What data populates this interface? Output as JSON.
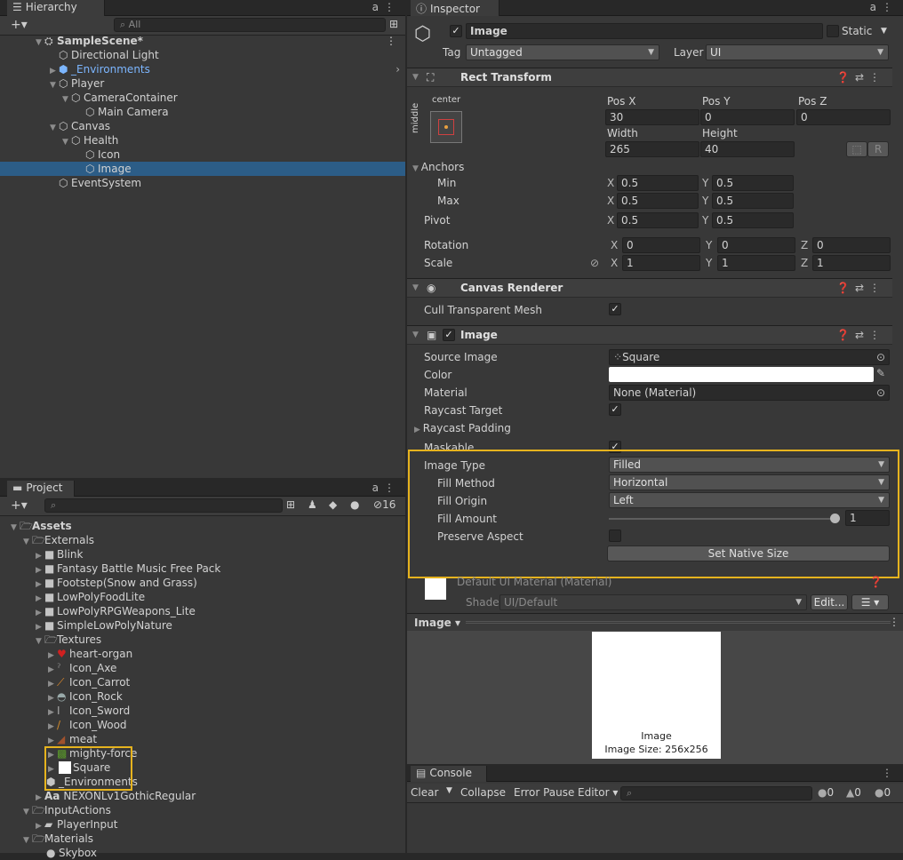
{
  "hierarchy": {
    "tab": "Hierarchy",
    "search_placeholder": "All",
    "add_label": "+▾",
    "items": [
      {
        "label": "SampleScene*"
      },
      {
        "label": "Directional Light"
      },
      {
        "label": "_Environments"
      },
      {
        "label": "Player"
      },
      {
        "label": "CameraContainer"
      },
      {
        "label": "Main Camera"
      },
      {
        "label": "Canvas"
      },
      {
        "label": "Health"
      },
      {
        "label": "Icon"
      },
      {
        "label": "Image"
      },
      {
        "label": "EventSystem"
      }
    ]
  },
  "project": {
    "tab": "Project",
    "add_label": "+▾",
    "hidden_count": "16",
    "items": [
      {
        "label": "Assets"
      },
      {
        "label": "Externals"
      },
      {
        "label": "Blink"
      },
      {
        "label": "Fantasy Battle Music Free Pack"
      },
      {
        "label": "Footstep(Snow and Grass)"
      },
      {
        "label": "LowPolyFoodLite"
      },
      {
        "label": "LowPolyRPGWeapons_Lite"
      },
      {
        "label": "SimpleLowPolyNature"
      },
      {
        "label": "Textures"
      },
      {
        "label": "heart-organ"
      },
      {
        "label": "Icon_Axe"
      },
      {
        "label": "Icon_Carrot"
      },
      {
        "label": "Icon_Rock"
      },
      {
        "label": "Icon_Sword"
      },
      {
        "label": "Icon_Wood"
      },
      {
        "label": "meat"
      },
      {
        "label": "mighty-force"
      },
      {
        "label": "Square"
      },
      {
        "label": "_Environments"
      },
      {
        "label": "NEXONLv1GothicRegular"
      },
      {
        "label": "InputActions"
      },
      {
        "label": "PlayerInput"
      },
      {
        "label": "Materials"
      },
      {
        "label": "Skybox"
      }
    ],
    "font_icon_label": "Aa"
  },
  "inspector": {
    "tab": "Inspector",
    "object_name": "Image",
    "static_label": "Static",
    "tag_label": "Tag",
    "tag_value": "Untagged",
    "layer_label": "Layer",
    "layer_value": "UI",
    "rect_transform": {
      "title": "Rect Transform",
      "anchor_h": "center",
      "anchor_v": "middle",
      "posx_label": "Pos X",
      "posx": "30",
      "posy_label": "Pos Y",
      "posy": "0",
      "posz_label": "Pos Z",
      "posz": "0",
      "width_label": "Width",
      "width": "265",
      "height_label": "Height",
      "height": "40",
      "r_label": "R",
      "anchors_label": "Anchors",
      "min_label": "Min",
      "min_x": "0.5",
      "min_y": "0.5",
      "max_label": "Max",
      "max_x": "0.5",
      "max_y": "0.5",
      "pivot_label": "Pivot",
      "pivot_x": "0.5",
      "pivot_y": "0.5",
      "rotation_label": "Rotation",
      "rot_x": "0",
      "rot_y": "0",
      "rot_z": "0",
      "scale_label": "Scale",
      "scale_x": "1",
      "scale_y": "1",
      "scale_z": "1",
      "x": "X",
      "y": "Y",
      "z": "Z"
    },
    "canvas_renderer": {
      "title": "Canvas Renderer",
      "cull_label": "Cull Transparent Mesh"
    },
    "image": {
      "title": "Image",
      "source_label": "Source Image",
      "source_value": "Square",
      "color_label": "Color",
      "material_label": "Material",
      "material_value": "None (Material)",
      "raycast_label": "Raycast Target",
      "raycast_padding_label": "Raycast Padding",
      "maskable_label": "Maskable",
      "image_type_label": "Image Type",
      "image_type_value": "Filled",
      "fill_method_label": "Fill Method",
      "fill_method_value": "Horizontal",
      "fill_origin_label": "Fill Origin",
      "fill_origin_value": "Left",
      "fill_amount_label": "Fill Amount",
      "fill_amount_value": "1",
      "fill_amount_fraction": 1,
      "preserve_label": "Preserve Aspect",
      "native_size_label": "Set Native Size"
    },
    "material": {
      "title": "Default UI Material (Material)",
      "shader_label": "Shader",
      "shader_value": "UI/Default",
      "edit_label": "Edit..."
    },
    "preview": {
      "dropdown": "Image ▾",
      "caption": "Image",
      "size": "Image Size: 256x256"
    }
  },
  "console": {
    "tab": "Console",
    "clear": "Clear",
    "collapse": "Collapse",
    "error_pause": "Error Pause",
    "editor": "Editor ▾",
    "info_count": "0",
    "warn_count": "0",
    "error_count": "0"
  },
  "colors": {
    "selection": "#2c5d87",
    "highlight": "#e6b31e",
    "prefab_blue": "#7cb6ff"
  }
}
